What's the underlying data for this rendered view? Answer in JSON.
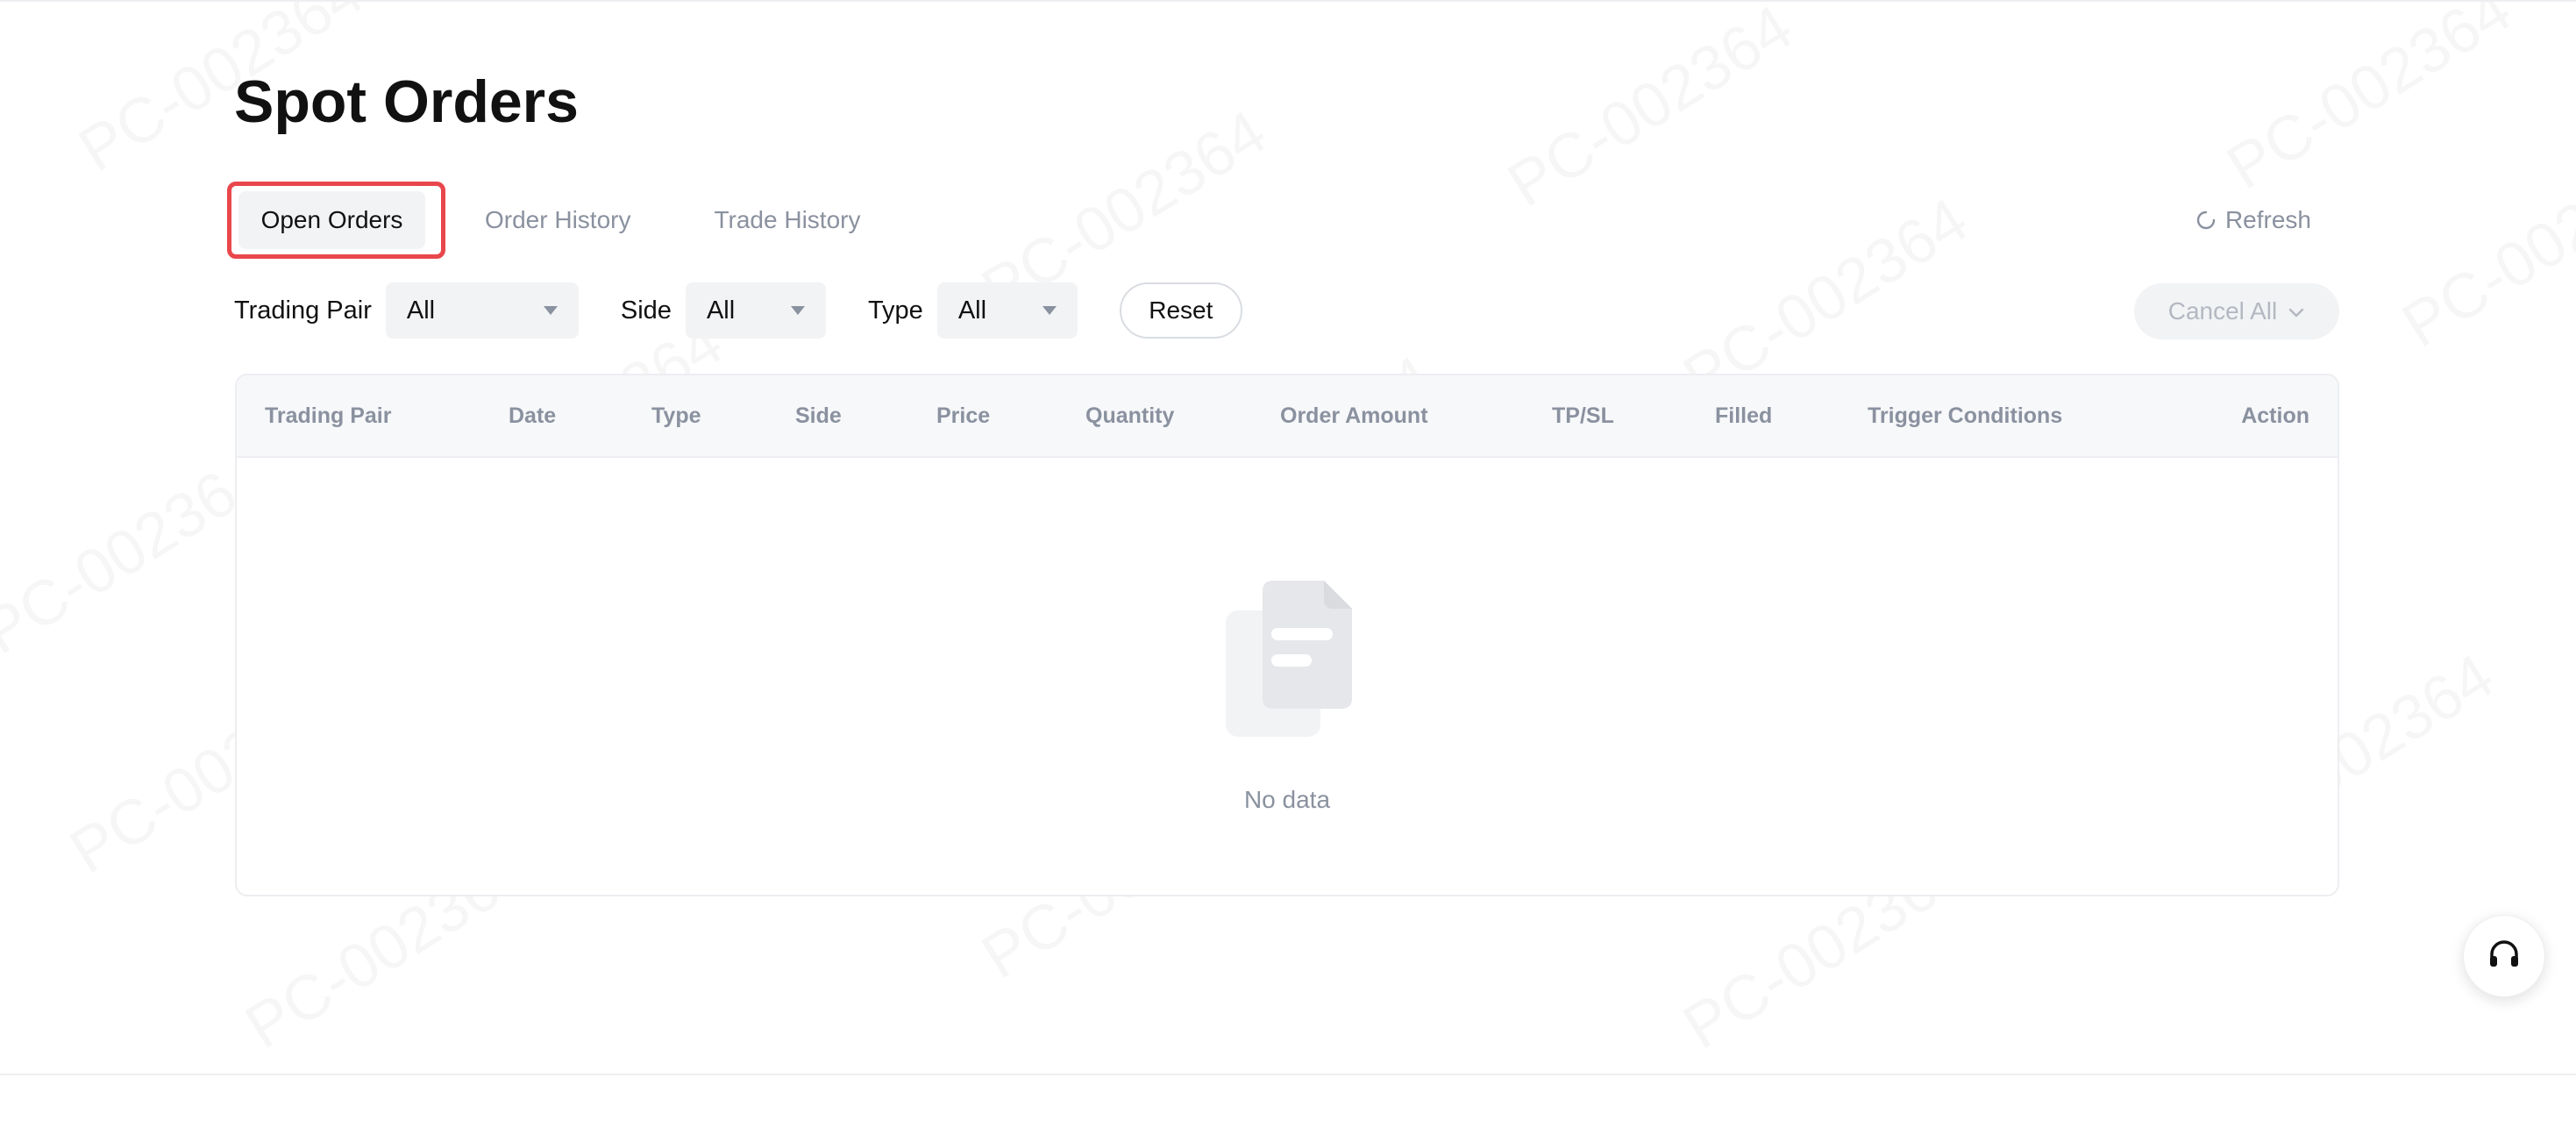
{
  "page": {
    "title": "Spot Orders",
    "watermark_text": "PC-002364"
  },
  "tabs": [
    {
      "label": "Open Orders",
      "active": true
    },
    {
      "label": "Order History",
      "active": false
    },
    {
      "label": "Trade History",
      "active": false
    }
  ],
  "toolbar": {
    "refresh_label": "Refresh",
    "cancel_all_label": "Cancel All"
  },
  "filters": {
    "trading_pair": {
      "label": "Trading Pair",
      "value": "All"
    },
    "side": {
      "label": "Side",
      "value": "All"
    },
    "type": {
      "label": "Type",
      "value": "All"
    },
    "reset_label": "Reset"
  },
  "table": {
    "columns": [
      "Trading Pair",
      "Date",
      "Type",
      "Side",
      "Price",
      "Quantity",
      "Order Amount",
      "TP/SL",
      "Filled",
      "Trigger Conditions",
      "Action"
    ],
    "rows": [],
    "empty_text": "No data"
  },
  "icons": {
    "refresh": "refresh-icon",
    "cancel_dropdown": "chevron-down-icon",
    "select_caret": "caret-down-icon",
    "empty": "empty-document-icon",
    "support": "headset-icon"
  },
  "colors": {
    "highlight_border": "#e8474c",
    "muted_text": "#8a919f",
    "select_bg": "#f2f3f5"
  }
}
